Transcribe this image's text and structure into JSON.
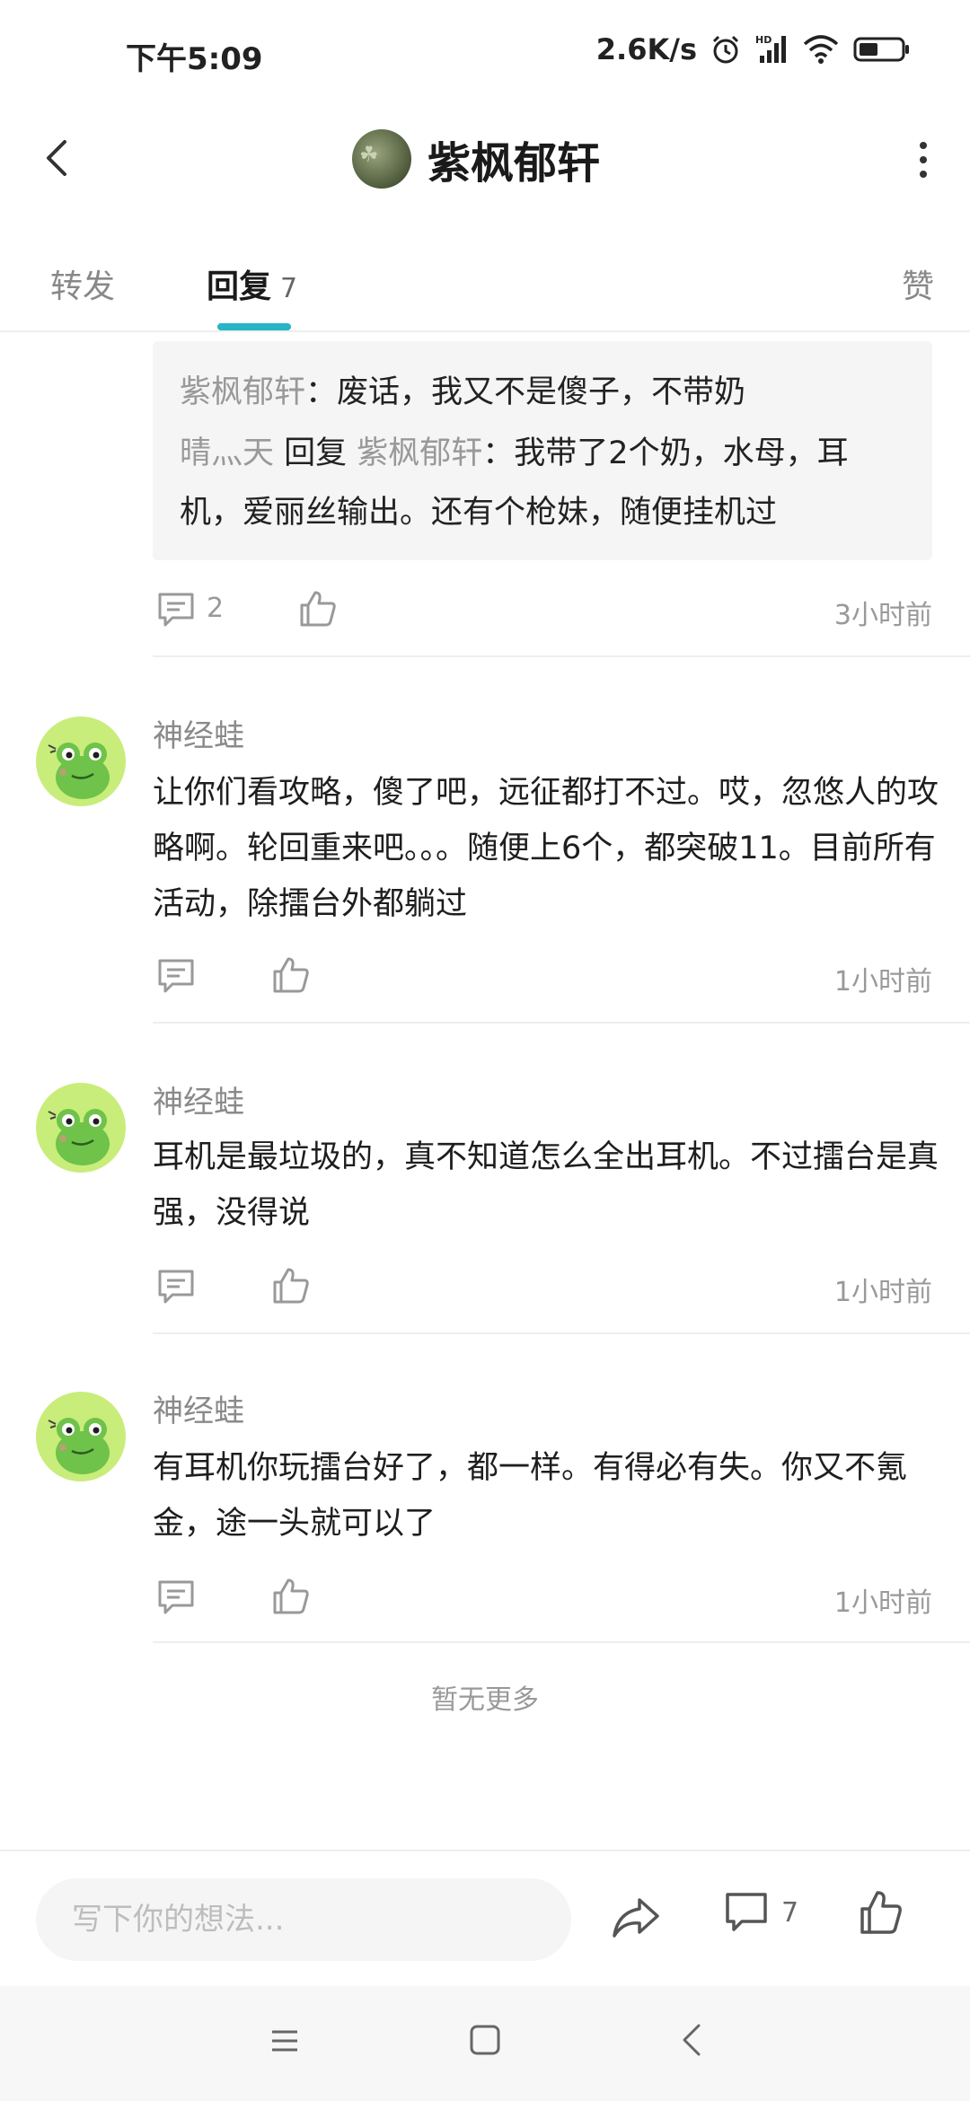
{
  "status_bar": {
    "time": "下午5:09",
    "net_speed": "2.6K/s",
    "icons": [
      "alarm-icon",
      "signal-hd-icon",
      "wifi-icon",
      "battery-icon"
    ]
  },
  "header": {
    "title": "紫枫郁轩",
    "back_icon": "chevron-left-icon",
    "more_icon": "more-vertical-icon"
  },
  "tabs": {
    "forward": "转发",
    "reply": "回复",
    "reply_count": "7",
    "like": "赞",
    "active": "reply",
    "accent_color": "#25b5c5"
  },
  "thread": {
    "quote_1_user": "紫枫郁轩",
    "quote_1_text": "：废话，我又不是傻子，不带奶",
    "quote_2_user": "晴灬天",
    "quote_2_reply_word": " 回复 ",
    "quote_2_target": "紫枫郁轩",
    "quote_2_text_a": "：我带了2个奶，水母，耳",
    "quote_2_text_b": "机，爱丽丝输出。还有个枪妹，随便挂机过",
    "comment_count": "2",
    "time": "3小时前"
  },
  "comments": [
    {
      "user": "神经蛙",
      "text": "让你们看攻略，傻了吧，远征都打不过。哎，忽悠人的攻略啊。轮回重来吧。。。随便上6个，都突破11。目前所有活动，除擂台外都躺过",
      "time": "1小时前"
    },
    {
      "user": "神经蛙",
      "text": "耳机是最垃圾的，真不知道怎么全出耳机。不过擂台是真强，没得说",
      "time": "1小时前"
    },
    {
      "user": "神经蛙",
      "text": "有耳机你玩擂台好了，都一样。有得必有失。你又不氪金，途一头就可以了",
      "time": "1小时前"
    }
  ],
  "footer": {
    "no_more": "暂无更多"
  },
  "bottom_bar": {
    "placeholder": "写下你的想法...",
    "comment_count": "7"
  },
  "nav_bar": {
    "icons": [
      "menu-icon",
      "home-square-icon",
      "back-triangle-icon"
    ]
  }
}
